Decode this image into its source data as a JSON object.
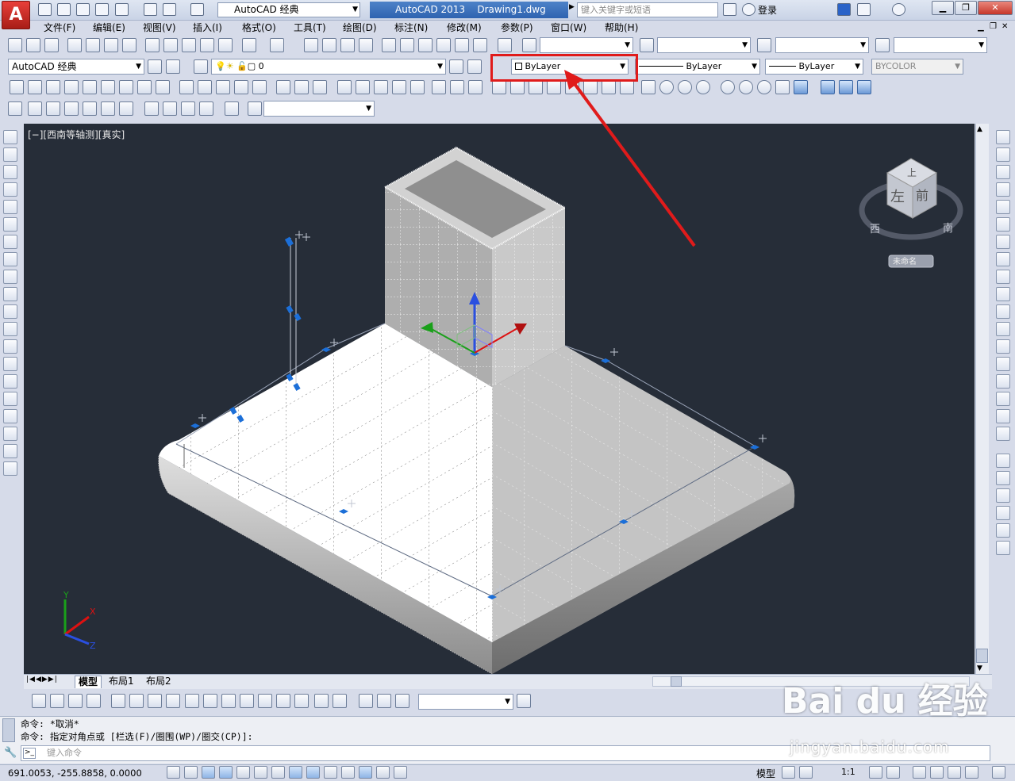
{
  "titlebar": {
    "app_logo": "A",
    "workspace": "AutoCAD 经典",
    "app_name": "AutoCAD 2013",
    "doc_name": "Drawing1.dwg",
    "search_placeholder": "键入关键字或短语",
    "login": "登录"
  },
  "menu": [
    "文件(F)",
    "编辑(E)",
    "视图(V)",
    "插入(I)",
    "格式(O)",
    "工具(T)",
    "绘图(D)",
    "标注(N)",
    "修改(M)",
    "参数(P)",
    "窗口(W)",
    "帮助(H)"
  ],
  "toolbar": {
    "workspace_combo": "AutoCAD 经典",
    "layer_combo": "0",
    "color_combo": "ByLayer",
    "linetype_combo": "ByLayer",
    "lineweight_combo": "ByLayer",
    "plotstyle_combo": "BYCOLOR"
  },
  "viewport": {
    "label": "[−][西南等轴测][真实]",
    "viewcube": {
      "top": "上",
      "left": "左",
      "front": "前",
      "west": "西",
      "south": "南",
      "ucs": "未命名"
    },
    "axis": {
      "x": "X",
      "y": "Y",
      "z": "Z"
    }
  },
  "tabs": [
    "模型",
    "布局1",
    "布局2"
  ],
  "command": {
    "line1": "命令: *取消*",
    "line2": "命令: 指定对角点或 [栏选(F)/圈围(WP)/圈交(CP)]:",
    "input_placeholder": "键入命令"
  },
  "status": {
    "coords": "691.0053,  -255.8858, 0.0000",
    "model": "模型",
    "scale": "1:1"
  },
  "watermark": {
    "brand": "Bai du 经验",
    "url": "jingyan.baidu.com"
  },
  "colors": {
    "highlight": "#e01b1b",
    "viewport_bg": "#262d38",
    "grip": "#1c6fd8"
  }
}
